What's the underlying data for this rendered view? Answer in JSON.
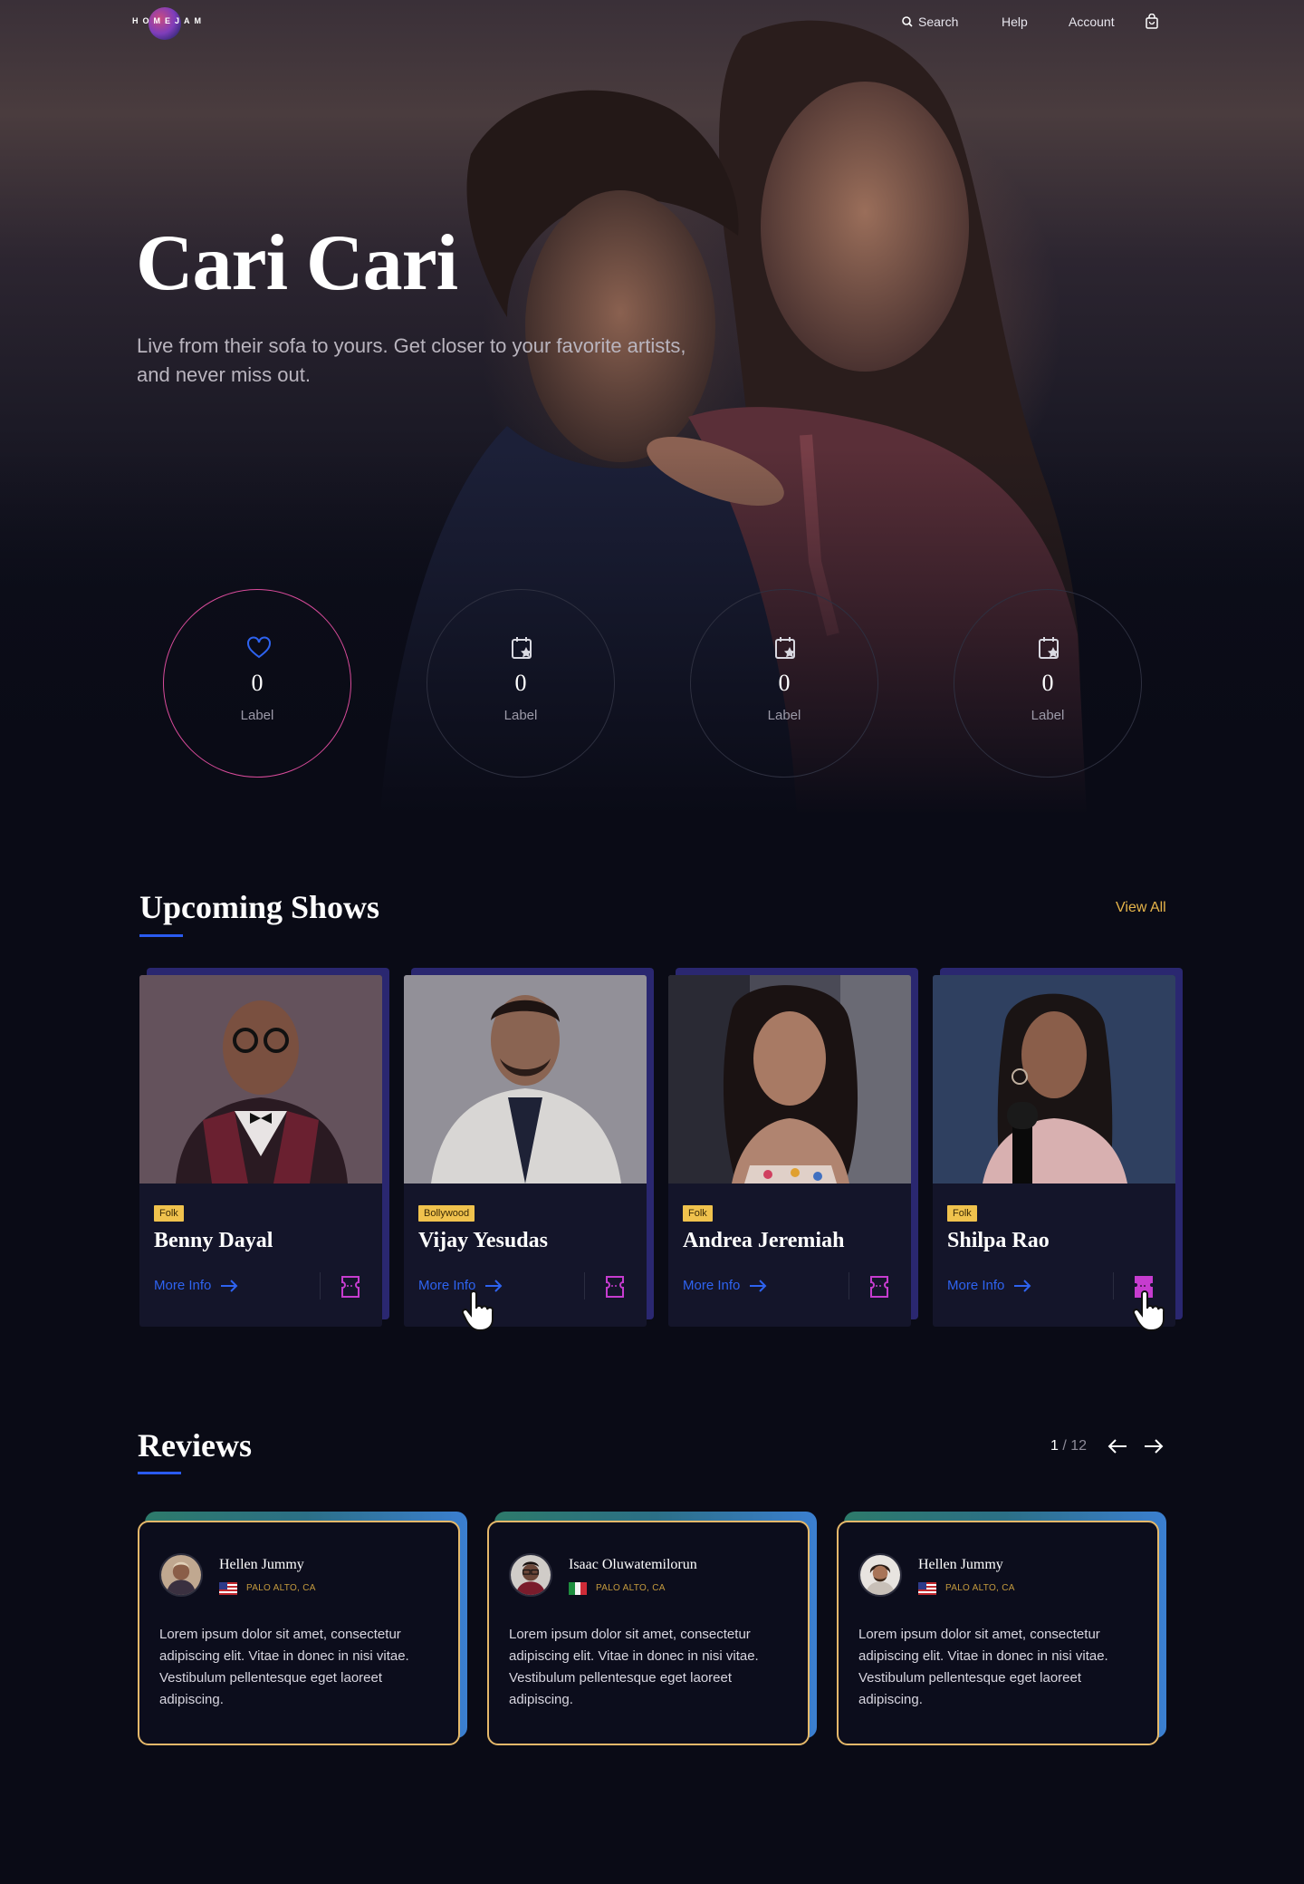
{
  "brand": {
    "logo_text": "HOMEJAM"
  },
  "nav": {
    "search": "Search",
    "help": "Help",
    "account": "Account"
  },
  "hero": {
    "title": "Cari Cari",
    "subtitle": "Live from their sofa to yours. Get closer to your favorite artists, and never miss out."
  },
  "stats": [
    {
      "value": "0",
      "label": "Label",
      "icon": "heart-icon"
    },
    {
      "value": "0",
      "label": "Label",
      "icon": "calendar-star-icon"
    },
    {
      "value": "0",
      "label": "Label",
      "icon": "calendar-star-icon"
    },
    {
      "value": "0",
      "label": "Label",
      "icon": "calendar-star-icon"
    }
  ],
  "upcoming": {
    "title": "Upcoming Shows",
    "view_all": "View All",
    "more_info": "More Info",
    "shows": [
      {
        "genre": "Folk",
        "name": "Benny Dayal"
      },
      {
        "genre": "Bollywood",
        "name": "Vijay Yesudas"
      },
      {
        "genre": "Folk",
        "name": "Andrea Jeremiah"
      },
      {
        "genre": "Folk",
        "name": "Shilpa Rao"
      }
    ]
  },
  "reviews": {
    "title": "Reviews",
    "page_current": "1",
    "page_total": "/ 12",
    "items": [
      {
        "name": "Hellen Jummy",
        "location": "PALO ALTO, CA",
        "flag": "us-flag-icon",
        "text": "Lorem ipsum dolor sit amet, consectetur adipiscing elit. Vitae in donec in nisi vitae. Vestibulum pellentesque eget laoreet adipiscing."
      },
      {
        "name": "Isaac Oluwatemilorun",
        "location": "PALO ALTO, CA",
        "flag": "italy-flag-icon",
        "text": "Lorem ipsum dolor sit amet, consectetur adipiscing elit. Vitae in donec in nisi vitae. Vestibulum pellentesque eget laoreet adipiscing."
      },
      {
        "name": "Hellen Jummy",
        "location": "PALO ALTO, CA",
        "flag": "us-flag-icon",
        "text": "Lorem ipsum dolor sit amet, consectetur adipiscing elit. Vitae in donec in nisi vitae. Vestibulum pellentesque eget laoreet adipiscing."
      }
    ]
  },
  "colors": {
    "accent_blue": "#2e63f0",
    "accent_pink": "#d84b9a",
    "accent_gold": "#e7b54a",
    "ticket_magenta": "#c63ccf"
  }
}
